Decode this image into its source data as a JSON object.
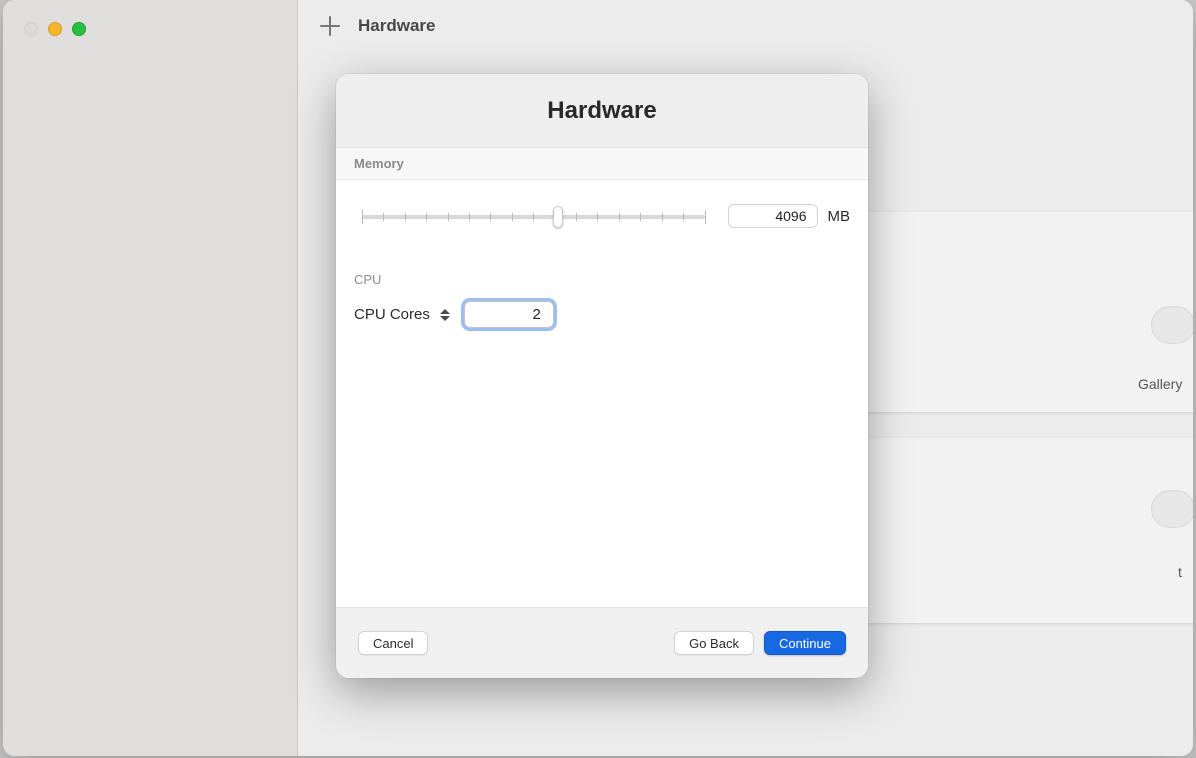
{
  "window": {
    "page_title": "Hardware"
  },
  "background": {
    "card1_label": "Gallery",
    "card2_label": "t"
  },
  "modal": {
    "title": "Hardware",
    "memory": {
      "section_label": "Memory",
      "value": "4096",
      "unit": "MB",
      "slider_percent": 57
    },
    "cpu": {
      "section_label": "CPU",
      "cores_label": "CPU Cores",
      "cores_value": "2"
    },
    "buttons": {
      "cancel": "Cancel",
      "goback": "Go Back",
      "continue": "Continue"
    }
  }
}
